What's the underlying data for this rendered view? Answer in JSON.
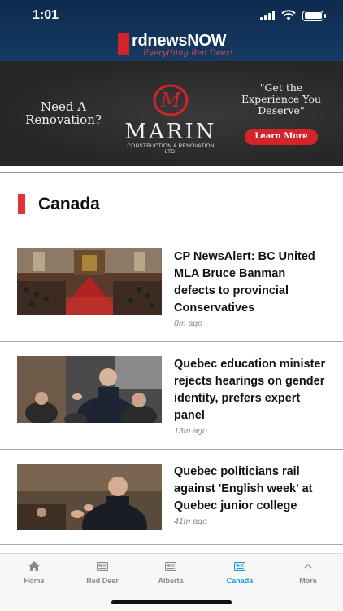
{
  "status_bar": {
    "time": "1:01"
  },
  "header": {
    "logo_title": "rdnewsNOW",
    "logo_tagline": "Everything Red Deer!"
  },
  "ad": {
    "left_text": "Need A Renovation?",
    "brand_name": "MARIN",
    "brand_sub": "CONSTRUCTION & RENOVATION LTD.",
    "right_text": "\"Get the Experience You Deserve\"",
    "button_label": "Learn More",
    "accent_color": "#d4242a"
  },
  "section": {
    "title": "Canada",
    "accent_color": "#e23238"
  },
  "articles": [
    {
      "title": "CP NewsAlert: BC United MLA Bruce Banman defects to provincial Conservatives",
      "time": "8m ago",
      "image_icon": "legislature-photo"
    },
    {
      "title": "Quebec education minister rejects hearings on gender identity, prefers expert panel",
      "time": "13m ago",
      "image_icon": "assembly-speaker-photo"
    },
    {
      "title": "Quebec politicians rail against 'English week' at Quebec junior college",
      "time": "41m ago",
      "image_icon": "politician-speaking-photo"
    }
  ],
  "tabbar": {
    "items": [
      {
        "label": "Home",
        "icon": "home-icon"
      },
      {
        "label": "Red Deer",
        "icon": "newspaper-icon"
      },
      {
        "label": "Alberta",
        "icon": "newspaper-icon"
      },
      {
        "label": "Canada",
        "icon": "newspaper-icon",
        "active": true
      },
      {
        "label": "More",
        "icon": "chevron-up-icon"
      }
    ],
    "active_color": "#1c9bd6"
  }
}
